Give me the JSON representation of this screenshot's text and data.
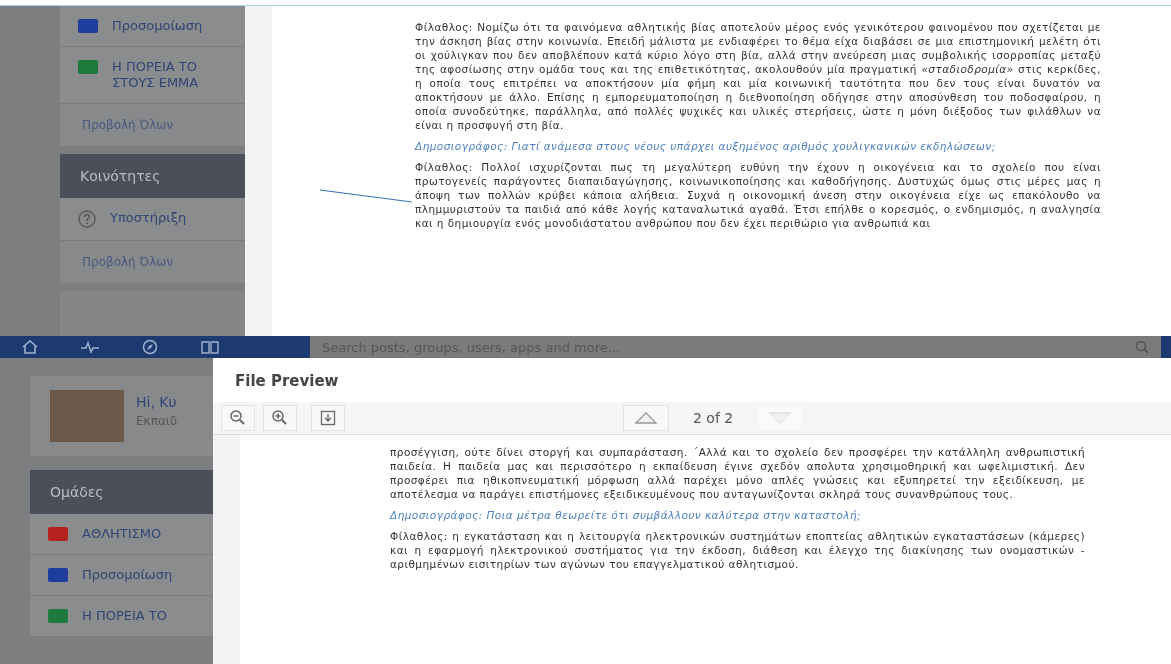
{
  "top_view": {
    "sidebar": {
      "items": [
        {
          "kind": "group",
          "label": "Προσομοίωση",
          "color": "#1f3d9c"
        },
        {
          "kind": "group",
          "label": "Η ΠΟΡΕΙΑ ΤΟ\nΣΤΟΥΣ ΕΜΜΑ",
          "color": "#1d7a3c"
        },
        {
          "kind": "link",
          "label": "Προβολή Όλων"
        },
        {
          "kind": "header",
          "label": "Κοινότητες"
        },
        {
          "kind": "support",
          "label": "Υποστήριξη"
        },
        {
          "kind": "link",
          "label": "Προβολή Όλων"
        }
      ]
    },
    "document": {
      "paragraphs": [
        {
          "kind": "answer",
          "text": "Φίλαθλος: Νομίζω ότι τα φαινόμενα αθλητικής βίας αποτελούν μέρος ενός γενικότερου φαινομένου που σχετίζεται με την άσκηση βίας στην κοινωνία. Επειδή μάλιστα με ενδιαφέρει το θέμα είχα διαβάσει σε μια επιστημονική μελέτη ότι οι χούλιγκαν που δεν αποβλέπουν κατά κύριο λόγο στη βία, αλλά στην ανεύρεση μιας συμβολικής ισορροπίας μεταξύ της αφοσίωσης στην ομάδα τους και της επιθετικότητας, ακολουθούν μία πραγματική *«σταδιοδρομία»* στις κερκίδες, η οποία τους επιτρέπει να αποκτήσουν μία φήμη και μία κοινωνική ταυτότητα που δεν τους είναι δυνατόν να αποκτήσουν με άλλο. Επίσης η εμπορευματοποίηση η διεθνοποίηση οδήγησε στην αποσύνθεση του ποδοσφαίρου, η οποία συνοδεύτηκε, παράλληλα, από πολλές ψυχικές και υλικές στερήσεις, ώστε η μόνη διέξοδος των φιλάθλων να είναι η προσφυγή στη βία."
        },
        {
          "kind": "question",
          "text": "Δημοσιογράφος: Γιατί ανάμεσα στους νέους υπάρχει αυξημένος αριθμός χουλιγκανικών εκδηλώσεων;"
        },
        {
          "kind": "answer",
          "text": "Φίλαθλος: Πολλοί ισχυρίζονται πως τη μεγαλύτερη ευθύνη την έχουν η οικογένεια και το σχολείο που είναι πρωτογενείς παράγοντες διαπαιδαγώγησης, κοινωνικοποίησης και καθοδήγησης. Δυστυχώς όμως στις μέρες μας η άποψη των πολλών κρύβει κάποια αλήθεια. Συχνά η οικονομική άνεση στην οικογένεια είχε ως επακόλουθο να πλημμυριστούν τα παιδιά από κάθε λογής καταναλωτικά αγαθά. Έτσι επήλθε ο κορεσμός, ο ενδημισμός, η αναλγησία και η δημιουργία ενός μονοδιάστατου ανθρώπου που δεν έχει περιθώριο για ανθρωπιά και"
        }
      ]
    }
  },
  "bottom_view": {
    "search": {
      "placeholder": "Search posts, groups, users, apps and more..."
    },
    "profile": {
      "greeting": "Hi, Κυ",
      "subtitle": "Εκπαιδ"
    },
    "sidebar": {
      "items": [
        {
          "kind": "header",
          "label": "Ομάδες"
        },
        {
          "kind": "group",
          "label": "ΑΘΛΗΤΙΣΜΟ",
          "color": "#b52222"
        },
        {
          "kind": "group",
          "label": "Προσομοίωση",
          "color": "#1f3d9c"
        },
        {
          "kind": "group",
          "label": "Η ΠΟΡΕΙΑ ΤΟ",
          "color": "#1d7a3c"
        }
      ]
    },
    "modal": {
      "title": "File Preview",
      "page_indicator": "2 of 2",
      "page_buttons": [
        {
          "kind": "up",
          "disabled": false
        },
        {
          "kind": "down",
          "disabled": true
        }
      ],
      "document": {
        "paragraphs": [
          {
            "kind": "answer",
            "text": "προσέγγιση, ούτε δίνει στοργή και συμπαράσταση. ΄Αλλά και το σχολείο δεν προσφέρει την κατάλληλη ανθρωπιστική παιδεία. Η παιδεία μας και περισσότερο η εκπαίδευση έγινε σχεδόν απολυτα χρησιμοθηρική και ωφελιμιστική. Δεν προσφέρει πια ηθικοπνευματική μόρφωση αλλά παρέχει μόνο απλές γνώσεις και εξυπηρετεί την εξειδίκευση, με αποτέλεσμα να παράγει επιστήμονες εξειδικευμένους που ανταγωνίζονται σκληρά τους συνανθρώπους τους."
          },
          {
            "kind": "question",
            "text": "Δημοσιογράφος: Ποια μέτρα θεωρείτε ότι συμβάλλουν καλύτερα στην καταστολή;"
          },
          {
            "kind": "answer",
            "text": "Φίλαθλος: η εγκατάσταση και η λειτουργία ηλεκτρονικών συστημάτων εποπτείας αθλητικών εγκαταστάσεων (κάμερες) και η εφαρμογή ηλεκτρονικού συστήματος για την έκδοση, διάθεση και έλεγχο της διακίνησης των ονομαστικών - αριθμημένων εισιτηρίων των αγώνων του επαγγελματικού αθλητισμού."
          }
        ]
      }
    }
  }
}
